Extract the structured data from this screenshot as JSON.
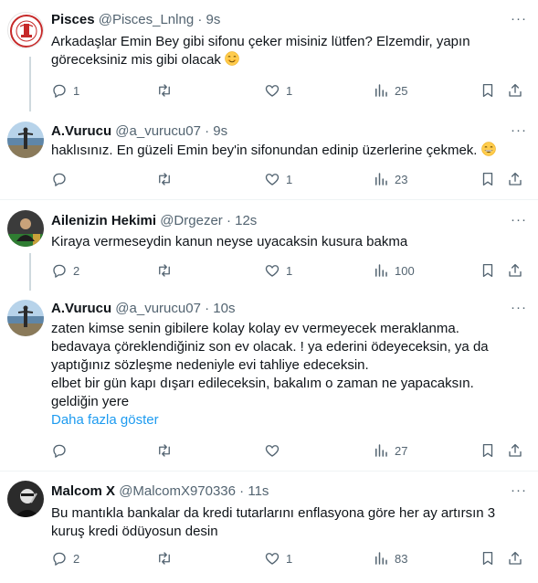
{
  "tweets": [
    {
      "name": "Pisces",
      "handle": "@Pisces_Lnlng",
      "time": "9s",
      "text_lines": [
        "Arkadaşlar Emin Bey gibi sifonu çeker misiniz lütfen? Elzemdir, yapın",
        "göreceksiniz mis gibi olacak"
      ],
      "emoji": "smiling-face-icon",
      "avatar_logo_text": "PİSCESLER",
      "replies": "1",
      "retweets": "",
      "likes": "1",
      "views": "25"
    },
    {
      "name": "A.Vurucu",
      "handle": "@a_vurucu07",
      "time": "9s",
      "text_lines": [
        "haklısınız. En güzeli Emin bey'in sifonundan edinip üzerlerine çekmek."
      ],
      "emoji": "grinning-face-icon",
      "replies": "",
      "retweets": "",
      "likes": "1",
      "views": "23"
    },
    {
      "name": "Ailenizin Hekimi",
      "handle": "@Drgezer",
      "time": "12s",
      "text_lines": [
        "Kiraya vermeseydin kanun neyse uyacaksin kusura bakma"
      ],
      "replies": "2",
      "retweets": "",
      "likes": "1",
      "views": "100"
    },
    {
      "name": "A.Vurucu",
      "handle": "@a_vurucu07",
      "time": "10s",
      "text_lines": [
        "zaten kimse senin gibilere kolay kolay ev vermeyecek meraklanma.",
        "bedavaya çöreklendiğiniz son ev olacak. ! ya ederini ödeyeceksin, ya da",
        "yaptığınız sözleşme nedeniyle evi tahliye edeceksin.",
        "elbet bir gün kapı dışarı edileceksin, bakalım o zaman ne yapacaksın.",
        "geldiğin yere"
      ],
      "show_more": "Daha fazla göster",
      "replies": "",
      "retweets": "",
      "likes": "",
      "views": "27"
    },
    {
      "name": "Malcom X",
      "handle": "@MalcomX970336",
      "time": "11s",
      "text_lines": [
        "Bu mantıkla bankalar da kredi tutarlarını enflasyona göre her ay artırsın 3",
        "kuruş kredi ödüyosun desin"
      ],
      "replies": "2",
      "retweets": "",
      "likes": "1",
      "views": "83"
    }
  ],
  "more_options": "···",
  "separator": "·",
  "colors": {
    "text": "#0f1419",
    "secondary": "#536471",
    "link": "#1d9bf0",
    "border": "#eff3f4",
    "thread": "#cfd9de"
  }
}
